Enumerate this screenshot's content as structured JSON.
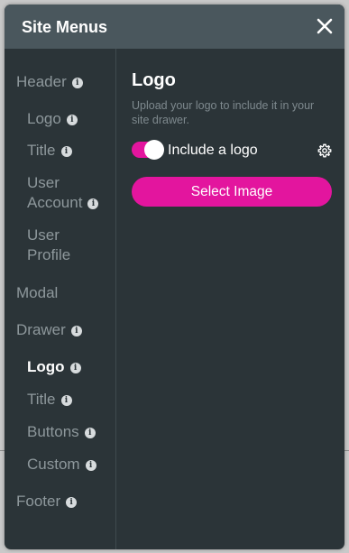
{
  "dialog": {
    "title": "Site Menus"
  },
  "sidebar": {
    "items": [
      {
        "label": "Header",
        "info": "i"
      },
      {
        "label": "Logo",
        "info": "i"
      },
      {
        "label": "Title",
        "info": "i"
      },
      {
        "label": "User",
        "label2": "Account",
        "info": "i"
      },
      {
        "label": "User",
        "label2": "Profile"
      },
      {
        "label": "Modal"
      },
      {
        "label": "Drawer",
        "info": "i"
      },
      {
        "label": "Logo",
        "info": "i",
        "active": true
      },
      {
        "label": "Title",
        "info": "i"
      },
      {
        "label": "Buttons",
        "info": "i"
      },
      {
        "label": "Custom",
        "info": "i"
      },
      {
        "label": "Footer",
        "info": "i"
      }
    ]
  },
  "main": {
    "title": "Logo",
    "description": "Upload your logo to include it in your site drawer.",
    "toggle": {
      "label": "Include a logo",
      "on": true
    },
    "button_label": "Select Image"
  },
  "colors": {
    "accent": "#e3159e",
    "panel": "#2b3438",
    "header": "#4a575d",
    "muted_text": "#8e989c"
  },
  "icons": [
    "close-icon",
    "info-icon",
    "gear-icon"
  ]
}
